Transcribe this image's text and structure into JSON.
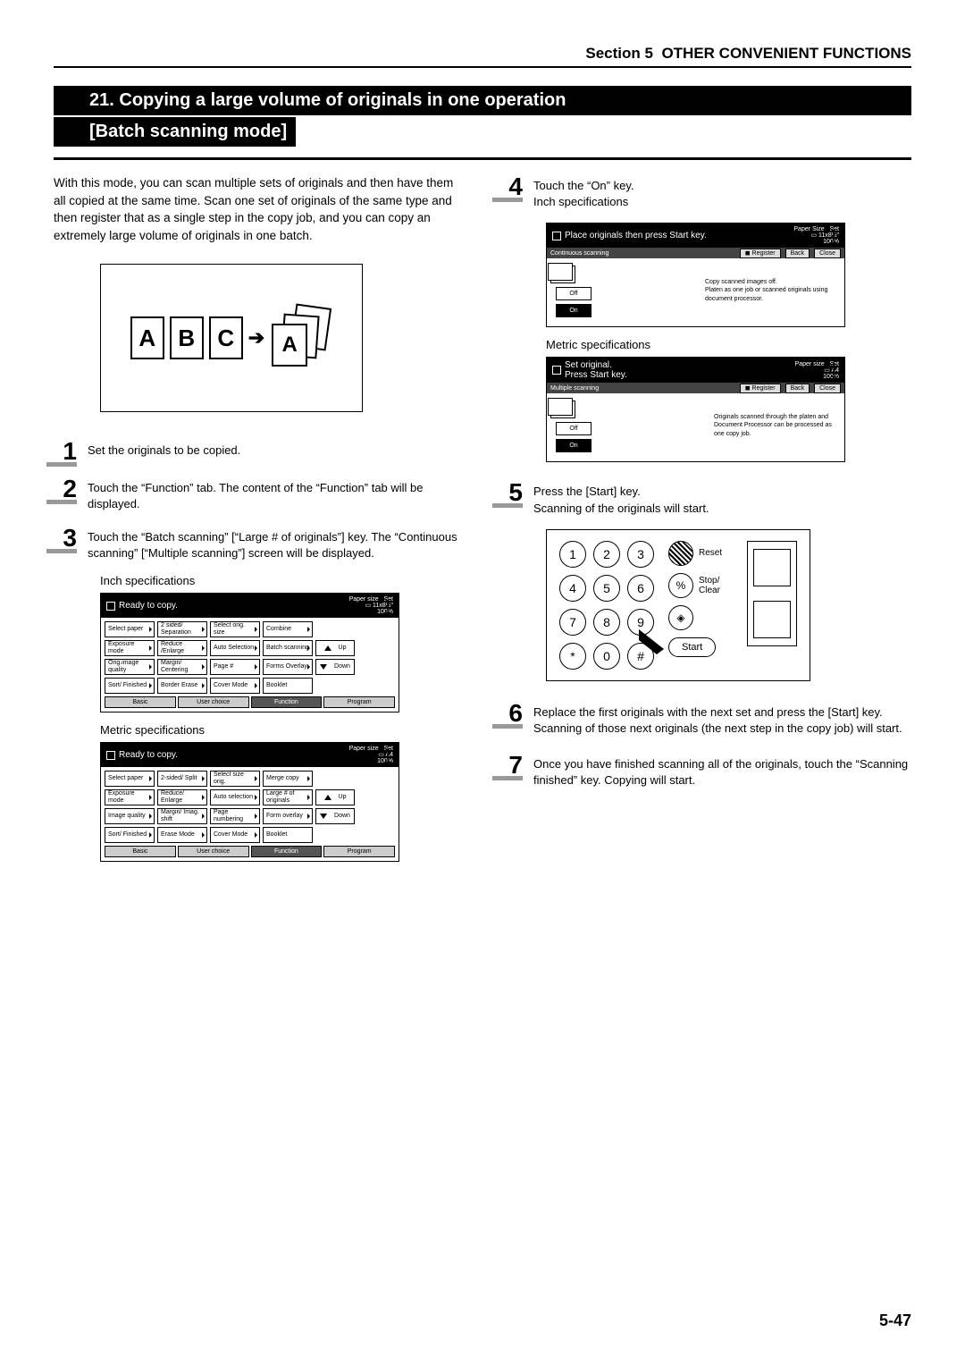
{
  "header": {
    "section": "Section 5",
    "title": "OTHER CONVENIENT FUNCTIONS"
  },
  "main": {
    "number": "21.",
    "title": "Copying a large volume of originals in one operation",
    "subtitle": "[Batch scanning mode]",
    "intro": "With this mode, you can scan multiple sets of originals and then have them all copied at the same time. Scan one set of originals of the same type and then register that as a single step in the copy job, and you can copy an extremely large volume of originals in one batch."
  },
  "illus": {
    "a": "A",
    "b": "B",
    "c": "C"
  },
  "steps": {
    "s1": {
      "n": "1",
      "t": "Set the originals to be copied."
    },
    "s2": {
      "n": "2",
      "t": "Touch the “Function” tab. The content of the “Function” tab will be displayed."
    },
    "s3": {
      "n": "3",
      "t": "Touch the “Batch scanning” [“Large # of originals”] key. The “Continuous scanning” [“Multiple scanning”] screen will be displayed."
    },
    "s4": {
      "n": "4",
      "t": "Touch the “On” key."
    },
    "s5": {
      "n": "5",
      "t": "Press the [Start] key.\nScanning of the originals will start."
    },
    "s6": {
      "n": "6",
      "t": "Replace the first originals with the next set and press the [Start] key. Scanning of those next originals (the next step in the copy job) will start."
    },
    "s7": {
      "n": "7",
      "t": "Once you have finished scanning all of the originals, touch the “Scanning finished” key. Copying will start."
    }
  },
  "captions": {
    "inch": "Inch specifications",
    "metric": "Metric specifications"
  },
  "lcd_inch": {
    "title": "Ready to copy.",
    "paper": "Paper size",
    "size": "11x8½\"",
    "zoom": "100%",
    "set": "Set",
    "count": "1",
    "rows": [
      [
        "Select paper",
        "2 sided/ Separation",
        "Select orig. size",
        "Combine"
      ],
      [
        "Exposure mode",
        "Reduce /Enlarge",
        "Auto Selection",
        "Batch scanning"
      ],
      [
        "Orig.image quality",
        "Margin/ Centering",
        "Page #",
        "Forms Overlay"
      ],
      [
        "Sort/ Finished",
        "Border Erase",
        "Cover Mode",
        "Booklet"
      ]
    ],
    "up": "Up",
    "down": "Down",
    "tabs": [
      "Basic",
      "User choice",
      "Function",
      "Program"
    ]
  },
  "lcd_metric": {
    "title": "Ready to copy.",
    "paper": "Paper size",
    "size": "A4",
    "zoom": "100%",
    "set": "Set",
    "count": "1",
    "rows": [
      [
        "Select paper",
        "2-sided/ Split",
        "Select size orig.",
        "Merge copy"
      ],
      [
        "Exposure mode",
        "Reduce/ Enlarge",
        "Auto selection",
        "Large # of originals"
      ],
      [
        "Image quality",
        "Margin/ Imag. shift",
        "Page numbering",
        "Form overlay"
      ],
      [
        "Sort/ Finished",
        "Erase Mode",
        "Cover Mode",
        "Booklet"
      ]
    ],
    "up": "Up",
    "down": "Down",
    "tabs": [
      "Basic",
      "User choice",
      "Function",
      "Program"
    ]
  },
  "lcd_cont_inch": {
    "head": "Place originals then press Start key.",
    "paper": "Paper Size",
    "size": "11x8½\"",
    "zoom": "100%",
    "set": "Set",
    "count": "1",
    "bar_title": "Continuous scanning",
    "register": "Register",
    "back": "Back",
    "close": "Close",
    "off": "Off",
    "on": "On",
    "desc": "Copy scanned images off.\nPlaten as one job or scanned originals using document processor."
  },
  "lcd_cont_metric": {
    "head1": "Set original.",
    "head2": "Press Start key.",
    "paper": "Paper size",
    "size": "A4",
    "zoom": "100%",
    "set": "Set",
    "count": "1",
    "bar_title": "Multiple scanning",
    "register": "Register",
    "back": "Back",
    "close": "Close",
    "off": "Off",
    "on": "On",
    "desc": "Originals scanned through the platen and Document Processor can be processed as one copy job."
  },
  "keypad": {
    "keys": [
      "1",
      "2",
      "3",
      "4",
      "5",
      "6",
      "7",
      "8",
      "9",
      "*",
      "0",
      "#"
    ],
    "reset": "Reset",
    "stop": "Stop/",
    "clear": "Clear",
    "start": "Start",
    "pct": "%"
  },
  "footer": {
    "page": "5-47"
  }
}
